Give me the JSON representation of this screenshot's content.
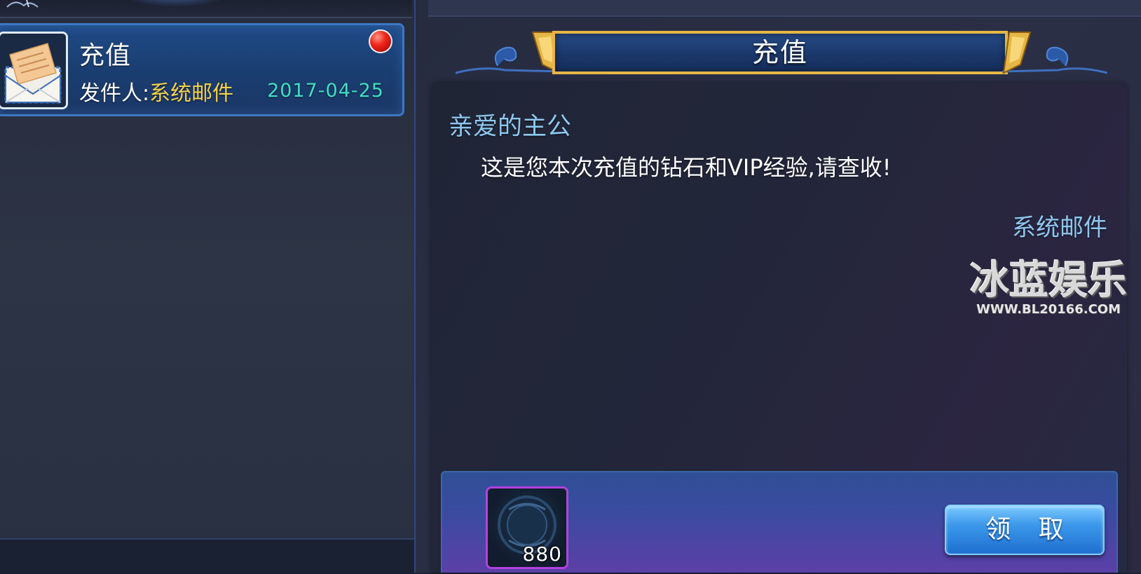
{
  "mail_list": {
    "items": [
      {
        "title": "充值",
        "sender_label": "发件人:",
        "sender_name": "系统邮件",
        "date": "2017-04-25",
        "unread": true,
        "icon": "envelope-icon"
      }
    ]
  },
  "mail_detail": {
    "title": "充值",
    "greeting": "亲爱的主公",
    "body": "这是您本次充值的钻石和VIP经验,请查收!",
    "signature": "系统邮件"
  },
  "attachments": {
    "items": [
      {
        "icon": "diamond-item-icon",
        "quantity": "880"
      }
    ],
    "claim_label": "领 取"
  },
  "watermark": {
    "title": "冰蓝娱乐",
    "url": "WWW.BL20166.COM"
  },
  "colors": {
    "sender_name": "#f3d24a",
    "date": "#3fe0c2",
    "greeting": "#8ec8f0",
    "banner_border": "#e6b746",
    "item_border": "#b341e0",
    "claim_button": "#3c98ea"
  }
}
